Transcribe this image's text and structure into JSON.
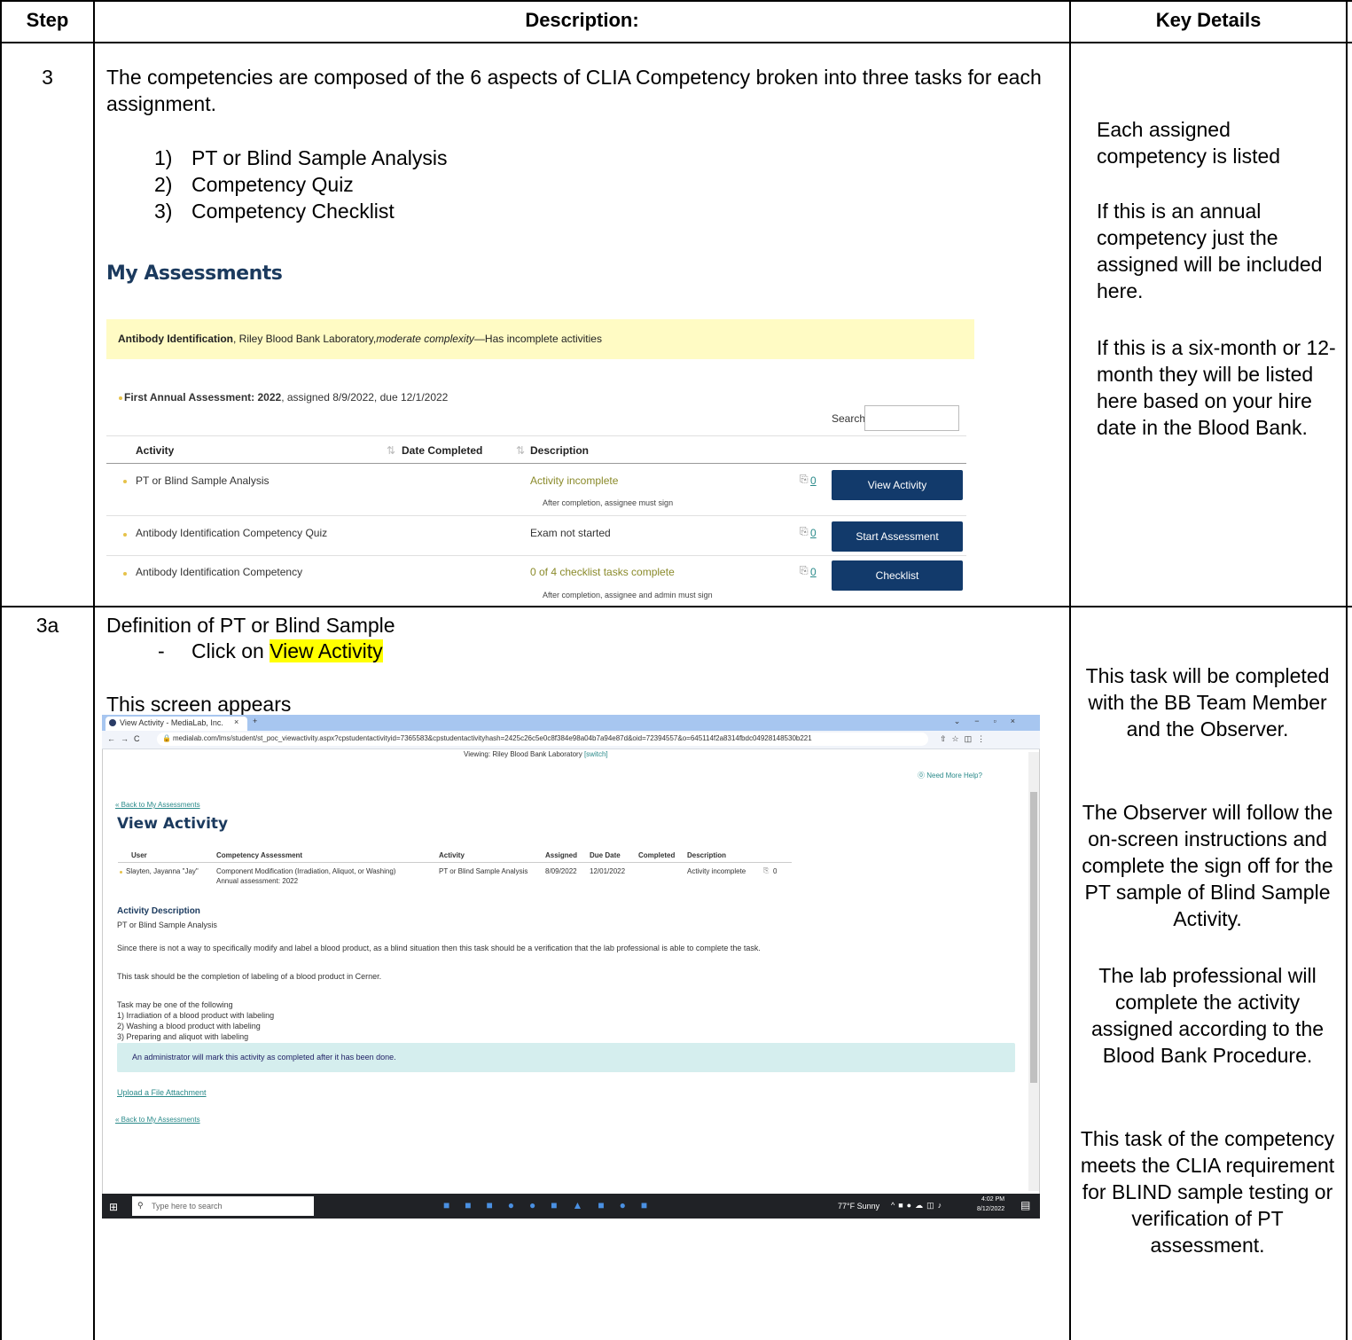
{
  "table": {
    "headers": {
      "step": "Step",
      "description": "Description:",
      "key": "Key Details"
    }
  },
  "row3": {
    "step": "3",
    "intro": "The competencies are composed of the 6 aspects of CLIA Competency broken into three tasks for each assignment.",
    "list": [
      {
        "num": "1)",
        "text": "PT or Blind Sample Analysis"
      },
      {
        "num": "2)",
        "text": "Competency Quiz"
      },
      {
        "num": "3)",
        "text": "Competency Checklist"
      }
    ],
    "key": [
      "Each assigned competency is listed",
      "If this is an annual competency just the assigned will be included here.",
      "If this is a six-month or 12-month they will be listed here based on your hire date in the Blood Bank."
    ]
  },
  "assess": {
    "title": "My Assessments",
    "banner_bold": "Antibody Identification",
    "banner_rest": ", Riley Blood Bank Laboratory,",
    "banner_italic": "moderate complexity",
    "banner_tail": "—Has incomplete activities",
    "annual_bold": "First Annual Assessment: 2022",
    "annual_rest": ", assigned 8/9/2022, due 12/1/2022",
    "search_label": "Search:",
    "col_activity": "Activity",
    "col_date": "Date Completed",
    "col_desc": "Description",
    "rows": [
      {
        "activity": "PT or Blind Sample Analysis",
        "desc": "Activity incomplete",
        "note": "After completion, assignee must sign",
        "count": "0",
        "button": "View Activity"
      },
      {
        "activity": "Antibody Identification Competency Quiz",
        "desc": "Exam not started",
        "note": "",
        "count": "0",
        "button": "Start Assessment"
      },
      {
        "activity": "Antibody Identification Competency",
        "desc": "0 of 4 checklist tasks complete",
        "note": "After completion, assignee and admin must sign",
        "count": "0",
        "button": "Checklist"
      }
    ]
  },
  "row3a": {
    "step": "3a",
    "line1": "Definition of PT or Blind Sample",
    "dash": "-",
    "click_prefix": "Click on ",
    "click_highlight": "View Activity",
    "appears": "This screen appears",
    "key": [
      "This task will be completed with the BB Team Member and the Observer.",
      "The Observer will follow the on-screen instructions and complete the sign off for the PT sample of Blind Sample Activity.",
      "The lab professional will complete the activity assigned according to the Blood Bank Procedure.",
      "This task of the competency meets the CLIA requirement for BLIND sample testing or verification of PT assessment."
    ]
  },
  "browser": {
    "tab_title": "View Activity - MediaLab, Inc.",
    "tab_close": "×",
    "tab_add": "+",
    "url": "medialab.com/lms/student/st_poc_viewactivity.aspx?cpstudentactivityid=7365583&cpstudentactivityhash=2425c26c5e0c8f384e98a04b7a94e87d&oid=72394557&o=645114f2a8314fbdc04928148530b221",
    "viewing": "Viewing: Riley Blood Bank Laboratory",
    "switch": "[switch]",
    "help": "⓪ Need More Help?",
    "back": "« Back to My Assessments",
    "page_title": "View Activity",
    "cols": [
      "User",
      "Competency Assessment",
      "Activity",
      "Assigned",
      "Due Date",
      "Completed",
      "Description"
    ],
    "row": {
      "user": "Slayten, Jayanna \"Jay\"",
      "assessment": "Component Modification (Irradiation, Aliquot, or Washing)",
      "sub": "Annual assessment: 2022",
      "activity": "PT or Blind Sample Analysis",
      "assigned": "8/09/2022",
      "due": "12/01/2022",
      "completed": "",
      "desc": "Activity incomplete",
      "count": "0"
    },
    "desc_title": "Activity Description",
    "desc_sub": "PT or Blind Sample Analysis",
    "para1": "Since there is not a way to specifically modify and label a blood product, as a blind situation then this task should be a verification that the lab professional is able to complete the task.",
    "para2": "This task should be the completion of labeling of a blood product in Cerner.",
    "list_intro": "Task may be one of the following",
    "list": [
      "1) Irradiation of a blood product with labeling",
      "2) Washing a blood product with labeling",
      "3) Preparing and aliquot with labeling"
    ],
    "notice": "An administrator will mark this activity as completed after it has been done.",
    "upload": "Upload a File Attachment",
    "back2": "« Back to My Assessments",
    "search_placeholder": "Type here to search",
    "weather": "77°F  Sunny",
    "time": "4:02 PM",
    "date": "8/12/2022"
  }
}
